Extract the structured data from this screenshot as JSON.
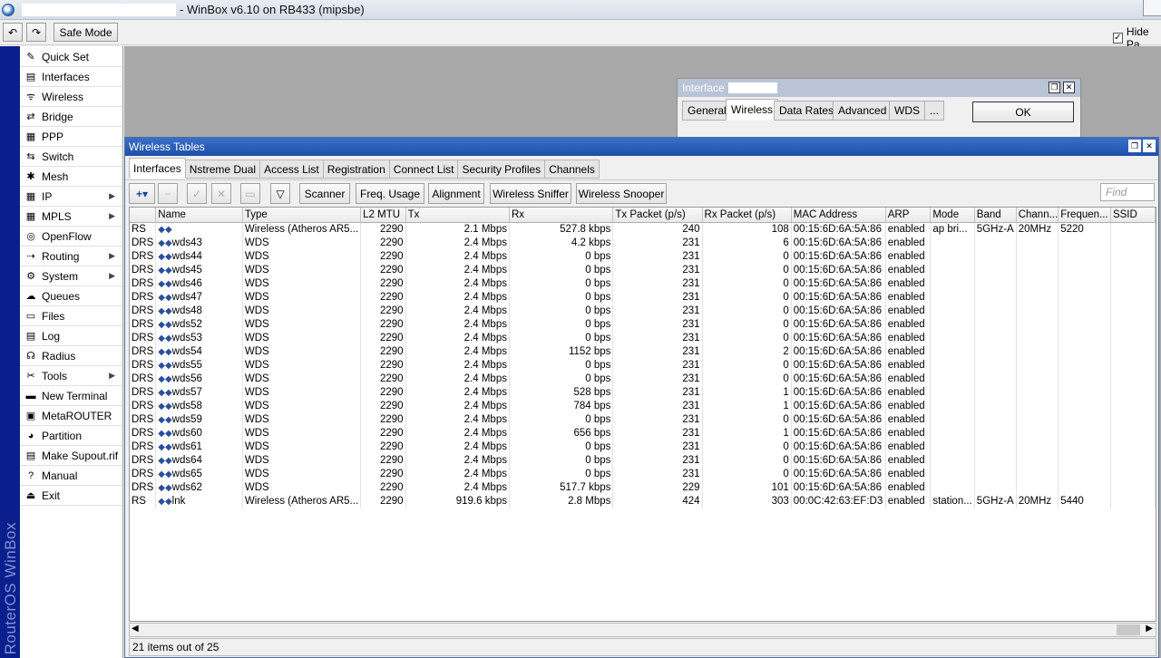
{
  "window": {
    "title": "- WinBox v6.10 on RB433 (mipsbe)"
  },
  "toolbar": {
    "safe_mode_label": "Safe Mode",
    "hide_passwords_label": "Hide Pa"
  },
  "brand": {
    "text": "RouterOS WinBox"
  },
  "sidebar": {
    "items": [
      {
        "label": "Quick Set",
        "icon": "quick-set-icon",
        "has_submenu": false
      },
      {
        "label": "Interfaces",
        "icon": "interfaces-icon",
        "has_submenu": false
      },
      {
        "label": "Wireless",
        "icon": "wireless-icon",
        "has_submenu": false
      },
      {
        "label": "Bridge",
        "icon": "bridge-icon",
        "has_submenu": false
      },
      {
        "label": "PPP",
        "icon": "ppp-icon",
        "has_submenu": false
      },
      {
        "label": "Switch",
        "icon": "switch-icon",
        "has_submenu": false
      },
      {
        "label": "Mesh",
        "icon": "mesh-icon",
        "has_submenu": false
      },
      {
        "label": "IP",
        "icon": "ip-icon",
        "has_submenu": true
      },
      {
        "label": "MPLS",
        "icon": "mpls-icon",
        "has_submenu": true
      },
      {
        "label": "OpenFlow",
        "icon": "openflow-icon",
        "has_submenu": false
      },
      {
        "label": "Routing",
        "icon": "routing-icon",
        "has_submenu": true
      },
      {
        "label": "System",
        "icon": "system-icon",
        "has_submenu": true
      },
      {
        "label": "Queues",
        "icon": "queues-icon",
        "has_submenu": false
      },
      {
        "label": "Files",
        "icon": "files-icon",
        "has_submenu": false
      },
      {
        "label": "Log",
        "icon": "log-icon",
        "has_submenu": false
      },
      {
        "label": "Radius",
        "icon": "radius-icon",
        "has_submenu": false
      },
      {
        "label": "Tools",
        "icon": "tools-icon",
        "has_submenu": true
      },
      {
        "label": "New Terminal",
        "icon": "terminal-icon",
        "has_submenu": false
      },
      {
        "label": "MetaROUTER",
        "icon": "metarouter-icon",
        "has_submenu": false
      },
      {
        "label": "Partition",
        "icon": "partition-icon",
        "has_submenu": false
      },
      {
        "label": "Make Supout.rif",
        "icon": "supout-icon",
        "has_submenu": false
      },
      {
        "label": "Manual",
        "icon": "manual-icon",
        "has_submenu": false
      },
      {
        "label": "Exit",
        "icon": "exit-icon",
        "has_submenu": false
      }
    ]
  },
  "interface_dialog": {
    "title": "Interface",
    "tabs": [
      "General",
      "Wireless",
      "Data Rates",
      "Advanced",
      "WDS",
      "..."
    ],
    "active_tab": "Wireless",
    "ok_label": "OK"
  },
  "wireless_tables": {
    "title": "Wireless Tables",
    "tabs": [
      "Interfaces",
      "Nstreme Dual",
      "Access List",
      "Registration",
      "Connect List",
      "Security Profiles",
      "Channels"
    ],
    "active_tab": "Interfaces",
    "actions": [
      "Scanner",
      "Freq. Usage",
      "Alignment",
      "Wireless Sniffer",
      "Wireless Snooper"
    ],
    "find_placeholder": "Find",
    "columns": [
      "",
      "Name",
      "Type",
      "L2 MTU",
      "Tx",
      "Rx",
      "Tx Packet (p/s)",
      "Rx Packet (p/s)",
      "MAC Address",
      "ARP",
      "Mode",
      "Band",
      "Chann...",
      "Frequen...",
      "SSID"
    ],
    "rows": [
      [
        "RS",
        "",
        "Wireless (Atheros AR5...",
        "2290",
        "2.1 Mbps",
        "527.8 kbps",
        "240",
        "108",
        "00:15:6D:6A:5A:86",
        "enabled",
        "ap bri...",
        "5GHz-A",
        "20MHz",
        "5220",
        ""
      ],
      [
        "DRS",
        "wds43",
        "WDS",
        "2290",
        "2.4 Mbps",
        "4.2 kbps",
        "231",
        "6",
        "00:15:6D:6A:5A:86",
        "enabled",
        "",
        "",
        "",
        "",
        ""
      ],
      [
        "DRS",
        "wds44",
        "WDS",
        "2290",
        "2.4 Mbps",
        "0 bps",
        "231",
        "0",
        "00:15:6D:6A:5A:86",
        "enabled",
        "",
        "",
        "",
        "",
        ""
      ],
      [
        "DRS",
        "wds45",
        "WDS",
        "2290",
        "2.4 Mbps",
        "0 bps",
        "231",
        "0",
        "00:15:6D:6A:5A:86",
        "enabled",
        "",
        "",
        "",
        "",
        ""
      ],
      [
        "DRS",
        "wds46",
        "WDS",
        "2290",
        "2.4 Mbps",
        "0 bps",
        "231",
        "0",
        "00:15:6D:6A:5A:86",
        "enabled",
        "",
        "",
        "",
        "",
        ""
      ],
      [
        "DRS",
        "wds47",
        "WDS",
        "2290",
        "2.4 Mbps",
        "0 bps",
        "231",
        "0",
        "00:15:6D:6A:5A:86",
        "enabled",
        "",
        "",
        "",
        "",
        ""
      ],
      [
        "DRS",
        "wds48",
        "WDS",
        "2290",
        "2.4 Mbps",
        "0 bps",
        "231",
        "0",
        "00:15:6D:6A:5A:86",
        "enabled",
        "",
        "",
        "",
        "",
        ""
      ],
      [
        "DRS",
        "wds52",
        "WDS",
        "2290",
        "2.4 Mbps",
        "0 bps",
        "231",
        "0",
        "00:15:6D:6A:5A:86",
        "enabled",
        "",
        "",
        "",
        "",
        ""
      ],
      [
        "DRS",
        "wds53",
        "WDS",
        "2290",
        "2.4 Mbps",
        "0 bps",
        "231",
        "0",
        "00:15:6D:6A:5A:86",
        "enabled",
        "",
        "",
        "",
        "",
        ""
      ],
      [
        "DRS",
        "wds54",
        "WDS",
        "2290",
        "2.4 Mbps",
        "1152 bps",
        "231",
        "2",
        "00:15:6D:6A:5A:86",
        "enabled",
        "",
        "",
        "",
        "",
        ""
      ],
      [
        "DRS",
        "wds55",
        "WDS",
        "2290",
        "2.4 Mbps",
        "0 bps",
        "231",
        "0",
        "00:15:6D:6A:5A:86",
        "enabled",
        "",
        "",
        "",
        "",
        ""
      ],
      [
        "DRS",
        "wds56",
        "WDS",
        "2290",
        "2.4 Mbps",
        "0 bps",
        "231",
        "0",
        "00:15:6D:6A:5A:86",
        "enabled",
        "",
        "",
        "",
        "",
        ""
      ],
      [
        "DRS",
        "wds57",
        "WDS",
        "2290",
        "2.4 Mbps",
        "528 bps",
        "231",
        "1",
        "00:15:6D:6A:5A:86",
        "enabled",
        "",
        "",
        "",
        "",
        ""
      ],
      [
        "DRS",
        "wds58",
        "WDS",
        "2290",
        "2.4 Mbps",
        "784 bps",
        "231",
        "1",
        "00:15:6D:6A:5A:86",
        "enabled",
        "",
        "",
        "",
        "",
        ""
      ],
      [
        "DRS",
        "wds59",
        "WDS",
        "2290",
        "2.4 Mbps",
        "0 bps",
        "231",
        "0",
        "00:15:6D:6A:5A:86",
        "enabled",
        "",
        "",
        "",
        "",
        ""
      ],
      [
        "DRS",
        "wds60",
        "WDS",
        "2290",
        "2.4 Mbps",
        "656 bps",
        "231",
        "1",
        "00:15:6D:6A:5A:86",
        "enabled",
        "",
        "",
        "",
        "",
        ""
      ],
      [
        "DRS",
        "wds61",
        "WDS",
        "2290",
        "2.4 Mbps",
        "0 bps",
        "231",
        "0",
        "00:15:6D:6A:5A:86",
        "enabled",
        "",
        "",
        "",
        "",
        ""
      ],
      [
        "DRS",
        "wds64",
        "WDS",
        "2290",
        "2.4 Mbps",
        "0 bps",
        "231",
        "0",
        "00:15:6D:6A:5A:86",
        "enabled",
        "",
        "",
        "",
        "",
        ""
      ],
      [
        "DRS",
        "wds65",
        "WDS",
        "2290",
        "2.4 Mbps",
        "0 bps",
        "231",
        "0",
        "00:15:6D:6A:5A:86",
        "enabled",
        "",
        "",
        "",
        "",
        ""
      ],
      [
        "DRS",
        "wds62",
        "WDS",
        "2290",
        "2.4 Mbps",
        "517.7 kbps",
        "229",
        "101",
        "00:15:6D:6A:5A:86",
        "enabled",
        "",
        "",
        "",
        "",
        ""
      ],
      [
        "RS",
        "lnk",
        "Wireless (Atheros AR5...",
        "2290",
        "919.6 kbps",
        "2.8 Mbps",
        "424",
        "303",
        "00:0C:42:63:EF:D3",
        "enabled",
        "station...",
        "5GHz-A",
        "20MHz",
        "5440",
        ""
      ]
    ],
    "status": "21 items out of 25"
  },
  "colors": {
    "brand_strip": "#0b1f8c",
    "title_bar_active": "#1e4fa8",
    "workspace": "#a9a9a9"
  }
}
